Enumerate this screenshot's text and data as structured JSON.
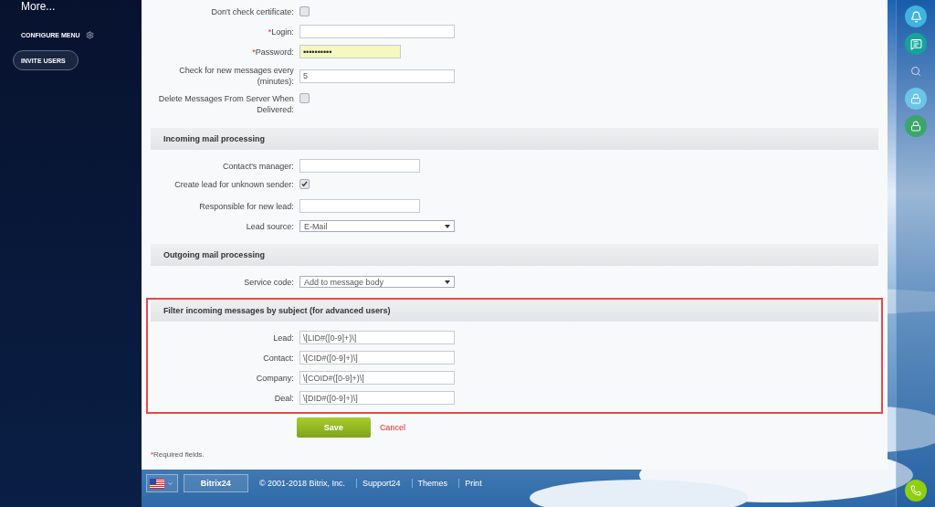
{
  "sidebar": {
    "more": {
      "label": "More..."
    },
    "configure_menu": {
      "label": "CONFIGURE MENU"
    },
    "invite_button": {
      "label": "INVITE USERS"
    }
  },
  "sections": [
    {
      "highlighted": false,
      "rows": [
        {
          "kind": "checkbox",
          "label": "Don't check certificate:",
          "checked": false
        },
        {
          "kind": "text",
          "mark": "*",
          "label": "Login:",
          "value": ""
        },
        {
          "kind": "password",
          "mark": "*",
          "label": "Password:",
          "value": "••••••••••"
        },
        {
          "kind": "text",
          "label": "Check for new messages every (minutes):",
          "value": "5"
        },
        {
          "kind": "checkbox",
          "label": "Delete Messages From Server When Delivered:",
          "checked": false
        }
      ]
    },
    {
      "heading": "Incoming mail processing",
      "highlighted": false,
      "rows": [
        {
          "kind": "short",
          "label": "Contact's manager:",
          "value": ""
        },
        {
          "kind": "checkbox",
          "label": "Create lead for unknown sender:",
          "checked": true
        },
        {
          "kind": "short",
          "label": "Responsible for new lead:",
          "value": ""
        },
        {
          "kind": "select",
          "label": "Lead source:",
          "value": "E-Mail"
        }
      ]
    },
    {
      "heading": "Outgoing mail processing",
      "highlighted": false,
      "rows": [
        {
          "kind": "select",
          "label": "Service code:",
          "value": "Add to message body"
        }
      ]
    },
    {
      "heading": "Filter incoming messages by subject (for advanced users)",
      "highlighted": true,
      "rows": [
        {
          "kind": "text",
          "label": "Lead:",
          "value": "\\[LID#([0-9]+)\\]"
        },
        {
          "kind": "text",
          "label": "Contact:",
          "value": "\\[CID#([0-9]+)\\]"
        },
        {
          "kind": "text",
          "label": "Company:",
          "value": "\\[COID#([0-9]+)\\]"
        },
        {
          "kind": "text",
          "label": "Deal:",
          "value": "\\[DID#([0-9]+)\\]"
        }
      ]
    }
  ],
  "actions": {
    "save": "Save",
    "cancel": "Cancel"
  },
  "note": {
    "mark": "*",
    "text": "Required fields."
  },
  "footer": {
    "brand": "Bitrix24",
    "copyright": "© 2001-2018 Bitrix, Inc.",
    "links": [
      "Support24",
      "Themes",
      "Print"
    ]
  }
}
